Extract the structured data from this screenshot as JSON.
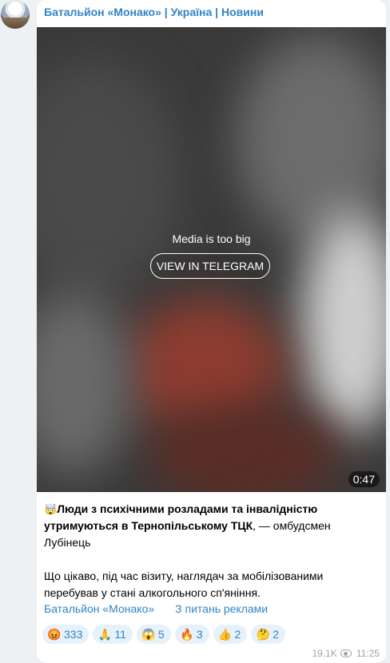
{
  "channel": {
    "name": "Батальйон «Монако» | Україна | Новини"
  },
  "media": {
    "notice": "Media is too big",
    "button_label": "VIEW IN TELEGRAM",
    "duration": "0:47"
  },
  "message": {
    "lead_emoji": "🤯",
    "bold_text": "Люди з психічними розладами та інвалідністю утримуються в Тернопільському ТЦК",
    "rest_text": ", — омбудсмен Лубінець",
    "paragraph2": "Що цікаво, під час візиту, наглядач за мобілізованими перебував у стані алкогольного сп'яніння."
  },
  "links": {
    "channel_link": "Батальйон «Монако»",
    "ads_link": "З питань реклами"
  },
  "reactions": [
    {
      "icon": "😡",
      "icon_name": "enraged-face-icon",
      "count": "333"
    },
    {
      "icon": "🙏",
      "icon_name": "folded-hands-icon",
      "count": "11"
    },
    {
      "icon": "😱",
      "icon_name": "screaming-face-icon",
      "count": "5"
    },
    {
      "icon": "🔥",
      "icon_name": "fire-icon",
      "count": "3"
    },
    {
      "icon": "👍",
      "icon_name": "thumbs-up-icon",
      "count": "2"
    },
    {
      "icon": "🤔",
      "icon_name": "thinking-face-icon",
      "count": "2"
    }
  ],
  "meta": {
    "views": "19.1K",
    "time": "11:25"
  },
  "colors": {
    "link": "#2f84c7",
    "reaction_bg": "#e7f1fb",
    "page_bg": "#eef1f4"
  }
}
